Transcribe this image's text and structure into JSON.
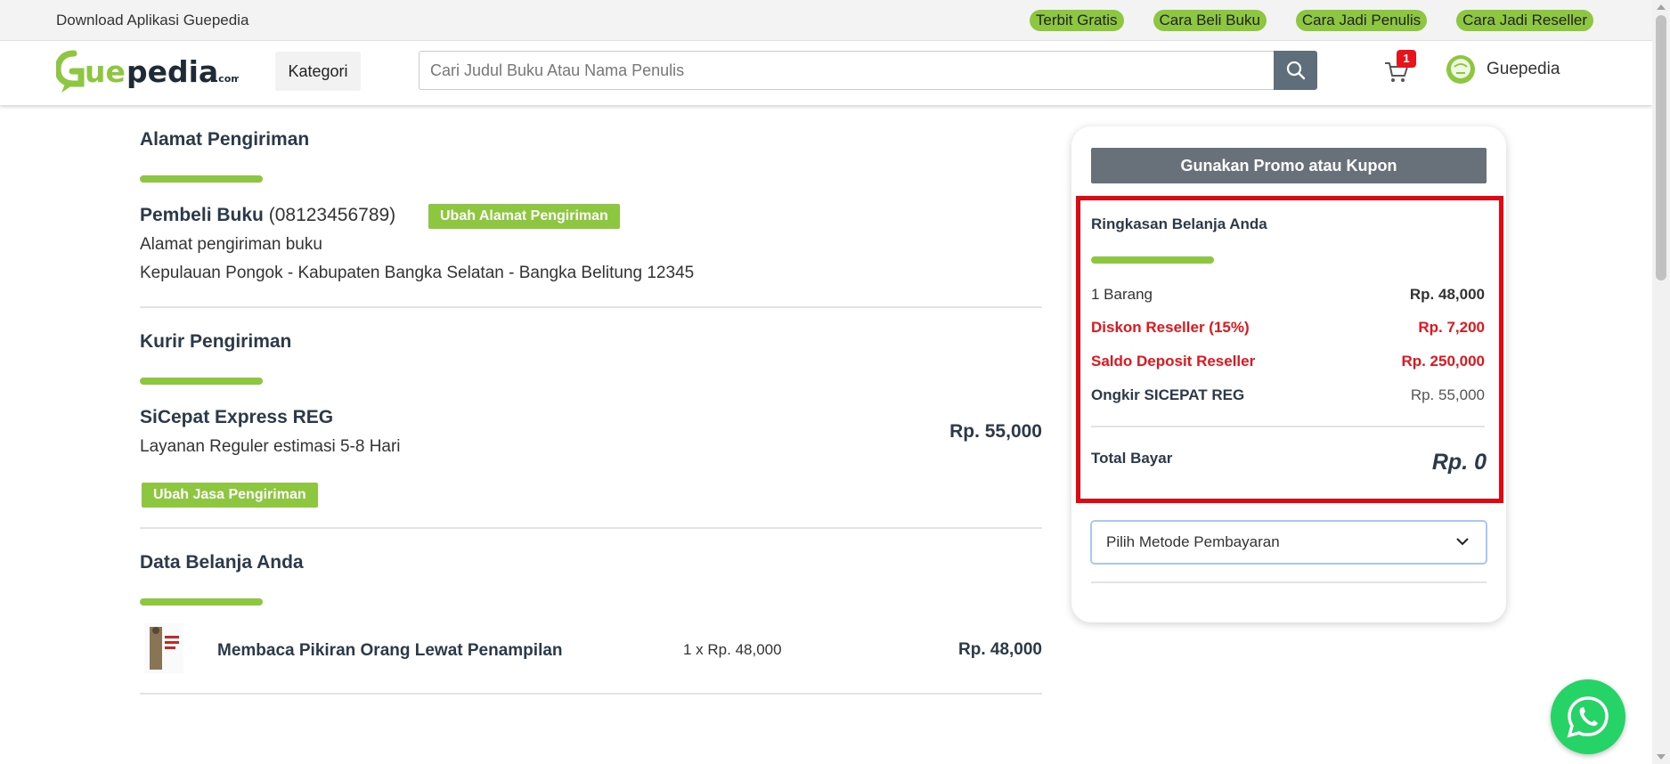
{
  "topbar": {
    "download_text": "Download Aplikasi Guepedia",
    "links": [
      "Terbit Gratis",
      "Cara Beli Buku",
      "Cara Jadi Penulis",
      "Cara Jadi Reseller"
    ]
  },
  "header": {
    "logo_text": "Guepedia",
    "logo_suffix": ".com",
    "kategori_label": "Kategori",
    "search_placeholder": "Cari Judul Buku Atau Nama Penulis",
    "cart_count": "1",
    "account_name": "Guepedia"
  },
  "alamat": {
    "title": "Alamat Pengiriman",
    "name": "Pembeli Buku",
    "phone": "(08123456789)",
    "change_button": "Ubah Alamat Pengiriman",
    "address_line1": "Alamat pengiriman buku",
    "address_line2": "Kepulauan Pongok - Kabupaten Bangka Selatan - Bangka Belitung 12345"
  },
  "kurir": {
    "title": "Kurir Pengiriman",
    "service": "SiCepat Express REG",
    "description": "Layanan Reguler estimasi 5-8 Hari",
    "price": "Rp. 55,000",
    "change_button": "Ubah Jasa Pengiriman"
  },
  "belanja": {
    "title": "Data Belanja Anda",
    "items": [
      {
        "title": "Membaca Pikiran Orang Lewat Penampilan",
        "qty_price": "1 x Rp. 48,000",
        "subtotal": "Rp. 48,000"
      }
    ]
  },
  "summary": {
    "promo_button": "Gunakan Promo atau Kupon",
    "title": "Ringkasan Belanja Anda",
    "rows": [
      {
        "label": "1 Barang",
        "value": "Rp. 48,000"
      },
      {
        "label": "Diskon Reseller (15%)",
        "value": "Rp. 7,200"
      },
      {
        "label": "Saldo Deposit Reseller",
        "value": "Rp. 250,000"
      },
      {
        "label": "Ongkir SICEPAT REG",
        "value": "Rp. 55,000"
      }
    ],
    "total_label": "Total Bayar",
    "total_value": "Rp. 0",
    "payment_select": "Pilih Metode Pembayaran"
  },
  "colors": {
    "brand_green": "#8dc63f",
    "highlight_red": "#e30613",
    "discount_red": "#e8141c",
    "navy_text": "#2b3a4a",
    "whatsapp": "#25d366"
  },
  "icons": [
    "search-icon",
    "cart-icon",
    "avatar-icon",
    "chevron-down-icon",
    "whatsapp-icon"
  ]
}
